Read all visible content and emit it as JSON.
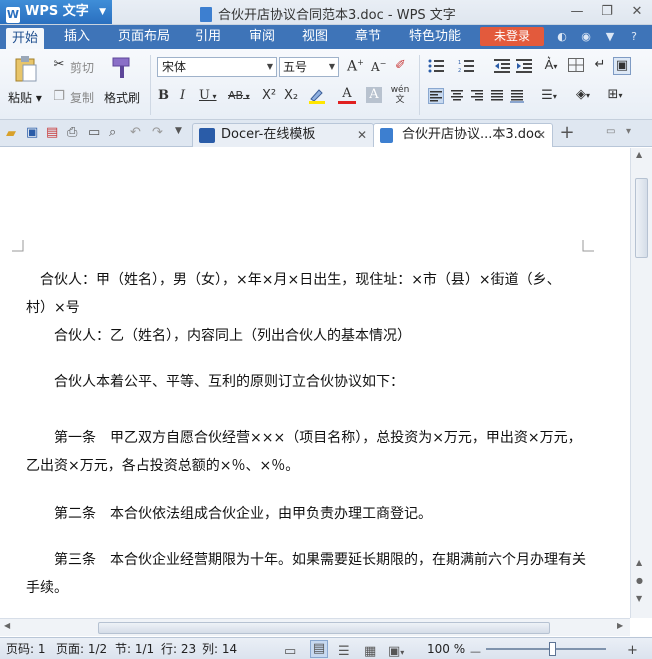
{
  "titlebar": {
    "app_name": "WPS 文字",
    "window_title": "合伙开店协议合同范本3.doc - WPS 文字",
    "minimize": "—",
    "restore": "❐",
    "close": "✕"
  },
  "menu": {
    "items": [
      "开始",
      "插入",
      "页面布局",
      "引用",
      "审阅",
      "视图",
      "章节",
      "特色功能"
    ],
    "login": "未登录"
  },
  "ribbon": {
    "paste": "粘贴",
    "cut": "剪切",
    "copy": "复制",
    "format_painter": "格式刷",
    "font_name": "宋体",
    "font_size": "五号",
    "bold": "B",
    "italic": "I",
    "underline": "U",
    "strike": "AB",
    "superscript": "X²",
    "subscript": "X₂",
    "grow_font": "A",
    "shrink_font": "A",
    "font_color": "A",
    "char_shade": "A"
  },
  "tabs": [
    {
      "label": "Docer-在线模板",
      "close": "✕"
    },
    {
      "label": "合伙开店协议...本3.doc",
      "close": "✕"
    }
  ],
  "tab_add": "+",
  "document": {
    "paragraphs": [
      "合伙人：甲（姓名），男（女），×年×月×日出生，现住址：×市（县）×街道（乡、",
      "村）×号",
      "合伙人：乙（姓名），内容同上（列出合伙人的基本情况）",
      "合伙人本着公平、平等、互利的原则订立合伙协议如下：",
      "第一条　甲乙双方自愿合伙经营×××（项目名称），总投资为×万元，甲出资×万元，",
      "乙出资×万元，各占投资总额的×％、×％。",
      "第二条　本合伙依法组成合伙企业，由甲负责办理工商登记。",
      "第三条　本合伙企业经营期限为十年。如果需要延长期限的，在期满前六个月办理有关",
      "手续。"
    ]
  },
  "status": {
    "page_num": "页码: 1",
    "page_of": "页面: 1/2",
    "section": "节: 1/1",
    "row": "行: 23",
    "col": "列: 14",
    "zoom": "100 %",
    "zoom_minus": "—",
    "zoom_plus": "+"
  },
  "colors": {
    "accent": "#3e74b8",
    "login_bg": "#e35a3c"
  }
}
